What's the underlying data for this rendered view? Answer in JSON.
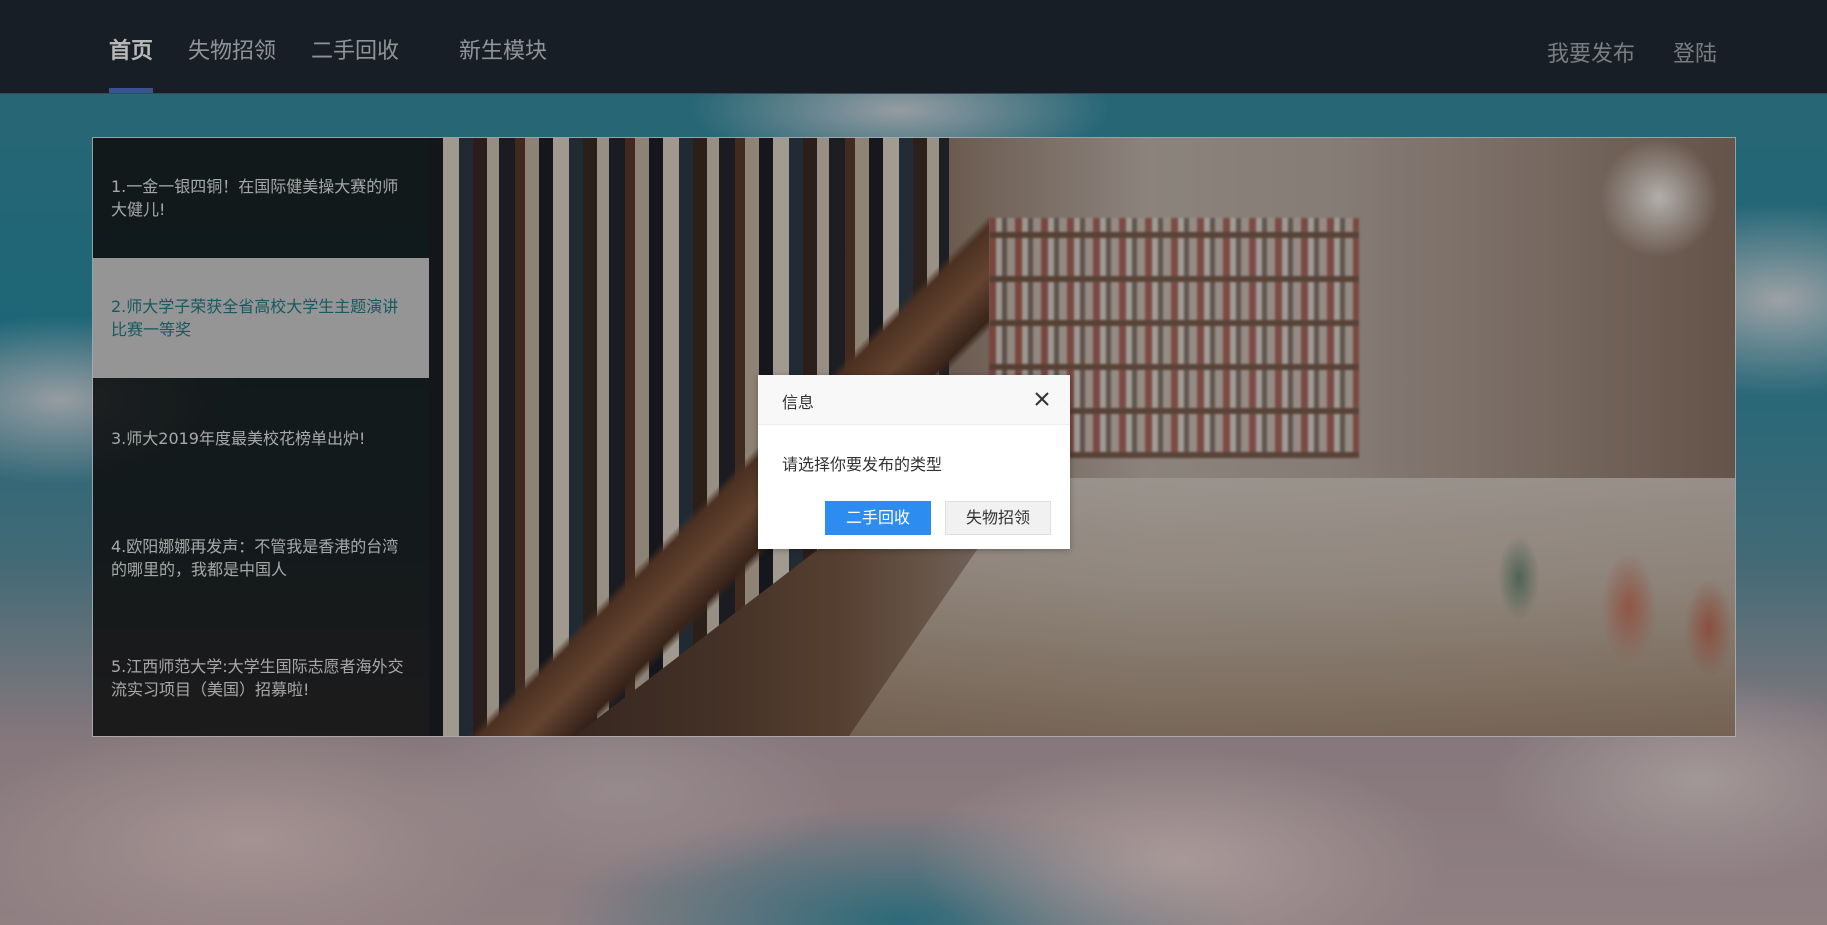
{
  "nav": {
    "items": [
      {
        "label": "首页",
        "active": true
      },
      {
        "label": "失物招领",
        "active": false
      },
      {
        "label": "二手回收",
        "active": false
      },
      {
        "label": "新生模块",
        "active": false
      }
    ],
    "publish_label": "我要发布",
    "login_label": "登陆",
    "accent_color": "#4a78c4"
  },
  "news": {
    "items": [
      {
        "text": "1.一金一银四铜！在国际健美操大赛的师大健儿!",
        "active": false
      },
      {
        "text": "2.师大学子荣获全省高校大学生主题演讲比赛一等奖",
        "active": true
      },
      {
        "text": "3.师大2019年度最美校花榜单出炉!",
        "active": false
      },
      {
        "text": "4.欧阳娜娜再发声：不管我是香港的台湾的哪里的，我都是中国人",
        "active": false
      },
      {
        "text": "5.江西师范大学:大学生国际志愿者海外交流实习项目（美国）招募啦!",
        "active": false
      }
    ],
    "active_text_color": "#1f7c86"
  },
  "dialog": {
    "title": "信息",
    "close_icon": "close-icon",
    "message": "请选择你要发布的类型",
    "primary_button": "二手回收",
    "secondary_button": "失物招领",
    "primary_color": "#2d8cf0"
  }
}
